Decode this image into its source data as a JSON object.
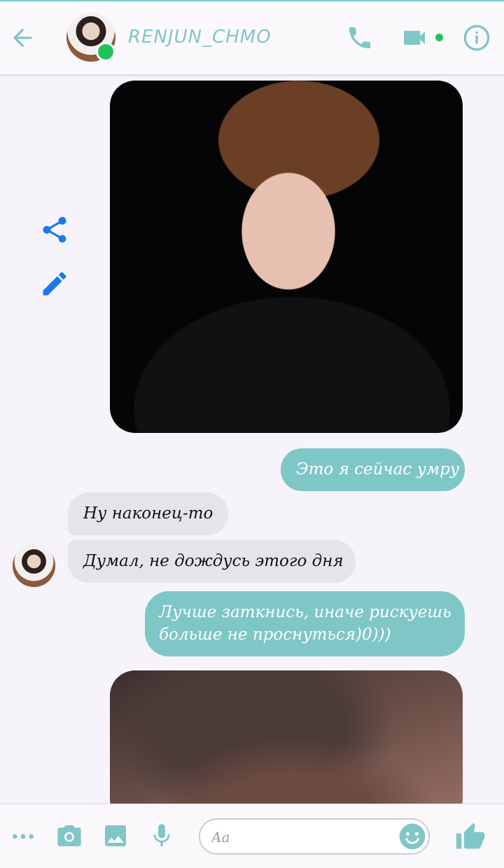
{
  "header": {
    "contact_name": "RENJUN_CHMO",
    "online": true
  },
  "messages": [
    {
      "type": "image",
      "direction": "outgoing",
      "description_icon": "photo"
    },
    {
      "type": "text",
      "direction": "outgoing",
      "text": "Это я сейчас умру"
    },
    {
      "type": "text",
      "direction": "incoming",
      "text": "Ну наконец-то"
    },
    {
      "type": "text",
      "direction": "incoming",
      "text": "Думал, не дождусь этого дня"
    },
    {
      "type": "text",
      "direction": "outgoing",
      "lines": [
        "Лучше заткнись, иначе рискуешь",
        "больше не проснуться)0)))"
      ]
    },
    {
      "type": "image",
      "direction": "outgoing",
      "description_icon": "photo"
    }
  ],
  "composer": {
    "placeholder": "Aa"
  },
  "colors": {
    "accent": "#7fc7c6",
    "outgoing_bubble": "#7fc7c6",
    "incoming_bubble": "#e6e4e9",
    "online": "#22c25a",
    "action_blue": "#1a7be8"
  },
  "icons": {
    "back": "arrow-left-icon",
    "call": "phone-icon",
    "video": "video-camera-icon",
    "info": "info-icon",
    "share": "share-icon",
    "edit": "pencil-icon",
    "more": "more-dots-icon",
    "camera": "camera-icon",
    "gallery": "image-icon",
    "mic": "microphone-icon",
    "emoji": "emoji-icon",
    "like": "thumbs-up-icon"
  }
}
